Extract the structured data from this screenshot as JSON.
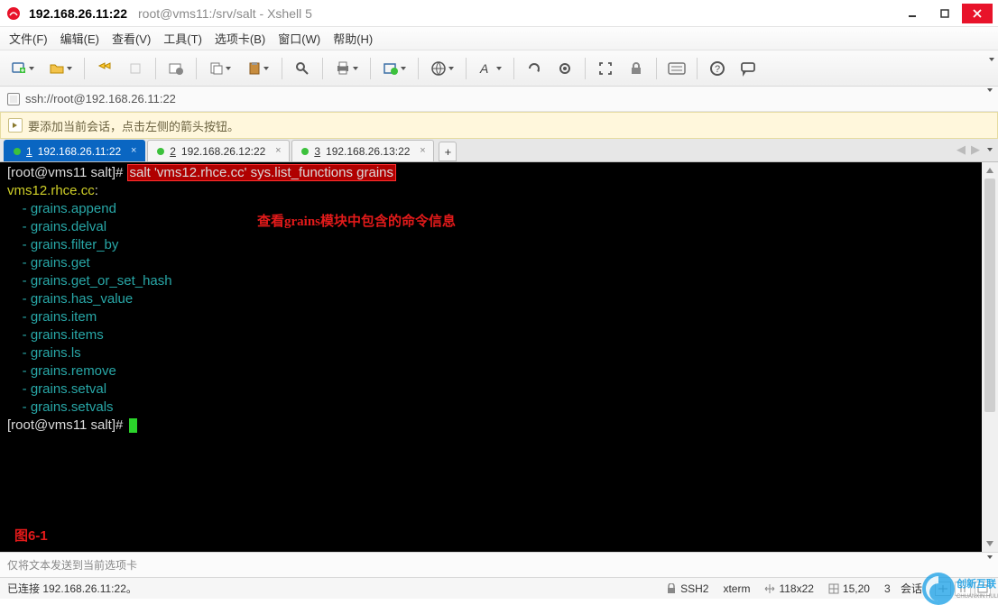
{
  "title": {
    "ip": "192.168.26.11:22",
    "sub": "root@vms11:/srv/salt - Xshell 5"
  },
  "menus": {
    "file": "文件(F)",
    "edit": "编辑(E)",
    "view": "查看(V)",
    "tools": "工具(T)",
    "tabs": "选项卡(B)",
    "window": "窗口(W)",
    "help": "帮助(H)"
  },
  "address": {
    "url": "ssh://root@192.168.26.11:22"
  },
  "info": {
    "text": "要添加当前会话，点击左侧的箭头按钮。"
  },
  "tabs": [
    {
      "num": "1",
      "label": "192.168.26.11:22",
      "active": true
    },
    {
      "num": "2",
      "label": "192.168.26.12:22",
      "active": false
    },
    {
      "num": "3",
      "label": "192.168.26.13:22",
      "active": false
    }
  ],
  "terminal": {
    "prompt1": "[root@vms11 salt]# ",
    "cmd": "salt 'vms12.rhce.cc' sys.list_functions grains",
    "host": "vms12.rhce.cc",
    "colon": ":",
    "lines": [
      "    - grains.append",
      "    - grains.delval",
      "    - grains.filter_by",
      "    - grains.get",
      "    - grains.get_or_set_hash",
      "    - grains.has_value",
      "    - grains.item",
      "    - grains.items",
      "    - grains.ls",
      "    - grains.remove",
      "    - grains.setval",
      "    - grains.setvals"
    ],
    "prompt2": "[root@vms11 salt]# "
  },
  "annotation": "查看grains模块中包含的命令信息",
  "figcaption": "图6-1",
  "sendbar": {
    "text": "仅将文本发送到当前选项卡"
  },
  "status": {
    "conn": "已连接 192.168.26.11:22。",
    "proto": "SSH2",
    "term": "xterm",
    "size": "118x22",
    "pos": "15,20",
    "sessions_num": "3",
    "sessions_label": "会话"
  },
  "icons": {
    "lock": "lock-icon"
  },
  "watermark": "创新互联"
}
